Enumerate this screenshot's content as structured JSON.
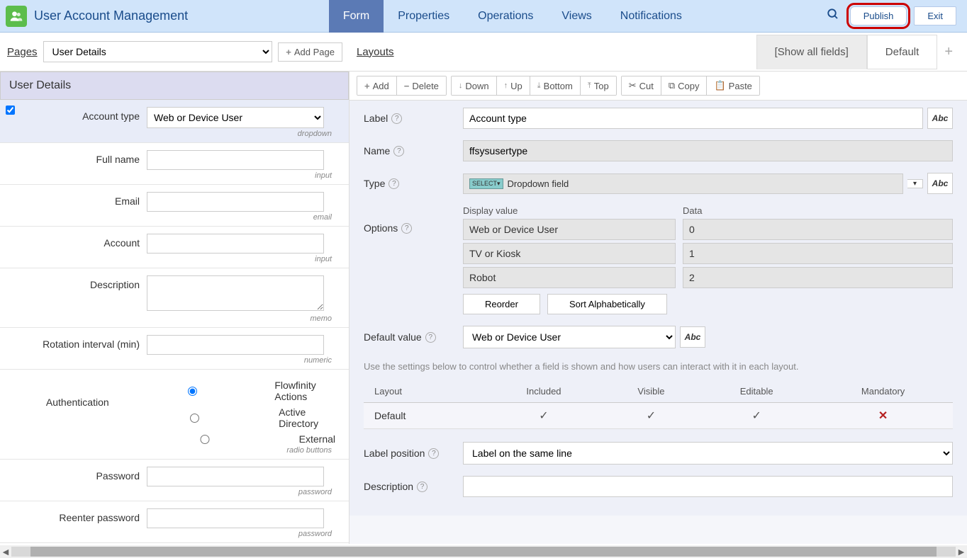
{
  "header": {
    "title": "User Account Management",
    "tabs": [
      "Form",
      "Properties",
      "Operations",
      "Views",
      "Notifications"
    ],
    "active_tab": 0,
    "publish": "Publish",
    "exit": "Exit"
  },
  "pages": {
    "label": "Pages",
    "selected": "User Details",
    "add_page": "Add Page"
  },
  "layouts": {
    "label": "Layouts",
    "tabs": [
      "[Show all fields]",
      "Default"
    ],
    "active": 0
  },
  "left_panel": {
    "heading": "User Details",
    "fields": [
      {
        "label": "Account type",
        "type": "dropdown",
        "value": "Web or Device User",
        "selected": true
      },
      {
        "label": "Full name",
        "type": "input"
      },
      {
        "label": "Email",
        "type": "email"
      },
      {
        "label": "Account",
        "type": "input"
      },
      {
        "label": "Description",
        "type": "memo"
      },
      {
        "label": "Rotation interval (min)",
        "type": "numeric"
      },
      {
        "label": "Authentication",
        "type": "radio buttons",
        "options": [
          "Flowfinity Actions",
          "Active Directory",
          "External"
        ],
        "checked": 0
      },
      {
        "label": "Password",
        "type": "password"
      },
      {
        "label": "Reenter password",
        "type": "password"
      }
    ]
  },
  "toolbar": {
    "add": "Add",
    "delete": "Delete",
    "down": "Down",
    "up": "Up",
    "bottom": "Bottom",
    "top": "Top",
    "cut": "Cut",
    "copy": "Copy",
    "paste": "Paste"
  },
  "props": {
    "label_label": "Label",
    "label_value": "Account type",
    "name_label": "Name",
    "name_value": "ffsysusertype",
    "type_label": "Type",
    "type_value": "Dropdown field",
    "options_label": "Options",
    "options_headers": {
      "display": "Display value",
      "data": "Data"
    },
    "options": [
      {
        "display": "Web or Device User",
        "data": "0"
      },
      {
        "display": "TV or Kiosk",
        "data": "1"
      },
      {
        "display": "Robot",
        "data": "2"
      }
    ],
    "reorder": "Reorder",
    "sort_alpha": "Sort Alphabetically",
    "default_label": "Default value",
    "default_value": "Web or Device User",
    "help_text": "Use the settings below to control whether a field is shown and how users can interact with it in each layout.",
    "layout_headers": [
      "Layout",
      "Included",
      "Visible",
      "Editable",
      "Mandatory"
    ],
    "layout_row": {
      "name": "Default",
      "included": true,
      "visible": true,
      "editable": true,
      "mandatory": false
    },
    "label_position_label": "Label position",
    "label_position_value": "Label on the same line",
    "description_label": "Description",
    "abc": "Abc"
  }
}
